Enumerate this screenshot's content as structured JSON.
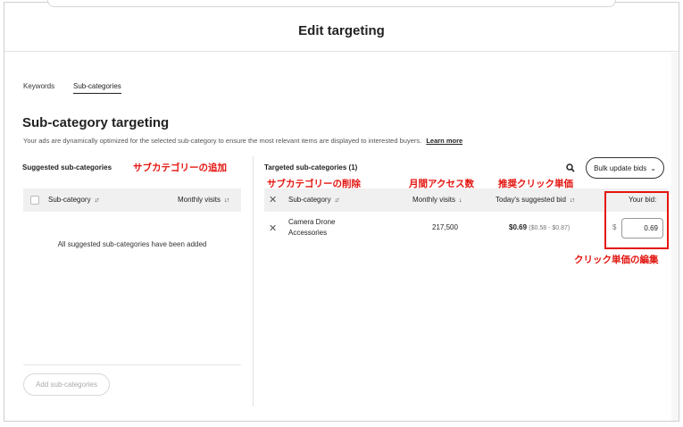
{
  "header": {
    "title": "Edit targeting"
  },
  "tabs": [
    {
      "label": "Keywords",
      "active": false
    },
    {
      "label": "Sub-categories",
      "active": true
    }
  ],
  "section": {
    "title": "Sub-category targeting",
    "description": "Your ads are dynamically optimized for the selected sub-category to ensure the most relevant items are displayed to interested buyers.",
    "learn_more": "Learn more"
  },
  "suggested": {
    "title": "Suggested sub-categories",
    "annotation": "サブカテゴリーの追加",
    "columns": {
      "subcategory": "Sub-category",
      "monthly_visits": "Monthly visits"
    },
    "empty_message": "All suggested sub-categories have been added",
    "add_button": "Add sub-categories"
  },
  "targeted": {
    "title": "Targeted sub-categories (1)",
    "bulk_button": "Bulk update bids",
    "annotations": {
      "remove": "サブカテゴリーの削除",
      "visits": "月間アクセス数",
      "suggested_bid": "推奨クリック単価",
      "edit_bid": "クリック単価の編集"
    },
    "columns": {
      "subcategory": "Sub-category",
      "monthly_visits": "Monthly visits",
      "suggested_bid": "Today's suggested bid",
      "your_bid": "Your bid:"
    },
    "rows": [
      {
        "name_line1": "Camera Drone",
        "name_line2": "Accessories",
        "monthly_visits": "217,500",
        "suggested_bid": "$0.69",
        "bid_range": "($0.58 - $0.87)",
        "currency": "$",
        "your_bid": "0.69"
      }
    ]
  },
  "icons": {
    "sort": "sort-arrows-icon",
    "sort_down": "arrow-down-icon",
    "search": "search-icon",
    "chevron": "chevron-down-icon",
    "remove": "close-icon"
  },
  "colors": {
    "annotation": "#e4140f",
    "header_bg": "#f0f0f0"
  }
}
